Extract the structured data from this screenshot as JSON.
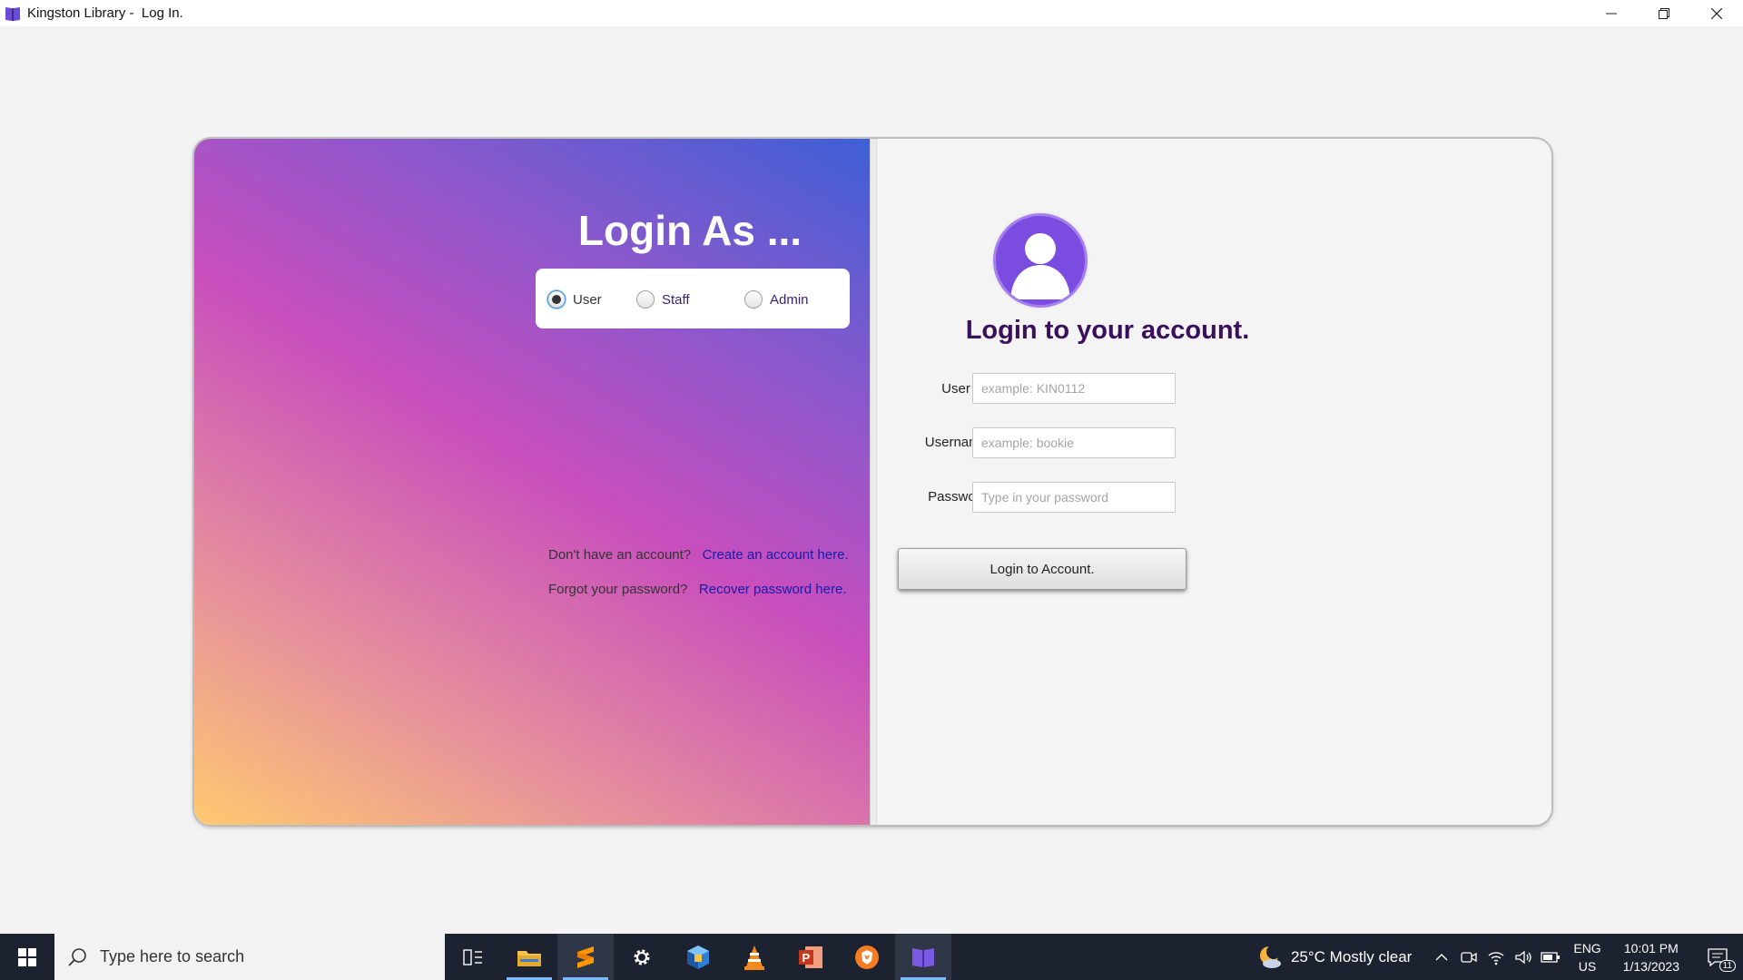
{
  "window": {
    "title": "Kingston Library -  Log In."
  },
  "login_panel": {
    "title": "Login As ...",
    "roles": [
      {
        "label": "User",
        "checked": true
      },
      {
        "label": "Staff",
        "checked": false
      },
      {
        "label": "Admin",
        "checked": false
      }
    ],
    "no_account_text": "Don't have an account?",
    "create_account_link": "Create an account here.",
    "forgot_text": "Forgot your password?",
    "recover_link": "Recover password here."
  },
  "form": {
    "heading": "Login to your account.",
    "user_id": {
      "label": "User ID",
      "placeholder": "example: KIN0112",
      "value": ""
    },
    "username": {
      "label": "Username",
      "placeholder": "example: bookie",
      "value": ""
    },
    "password": {
      "label": "Password",
      "placeholder": "Type in your password",
      "value": ""
    },
    "submit_label": "Login to Account."
  },
  "taskbar": {
    "search_placeholder": "Type here to search",
    "apps": [
      "task-view",
      "file-explorer",
      "sublime-text",
      "settings",
      "virtualbox",
      "vlc",
      "powerpoint",
      "brave",
      "library-app"
    ],
    "weather": "25°C  Mostly clear",
    "lang_line1": "ENG",
    "lang_line2": "US",
    "time": "10:01 PM",
    "date": "1/13/2023",
    "notification_count": "11"
  },
  "colors": {
    "gradient_start": "#ffc96f",
    "gradient_mid": "#c84ebd",
    "gradient_end": "#3e5fd6",
    "heading": "#3a0f5c",
    "link": "#1a1aa8",
    "avatar": "#7a4ce0"
  }
}
